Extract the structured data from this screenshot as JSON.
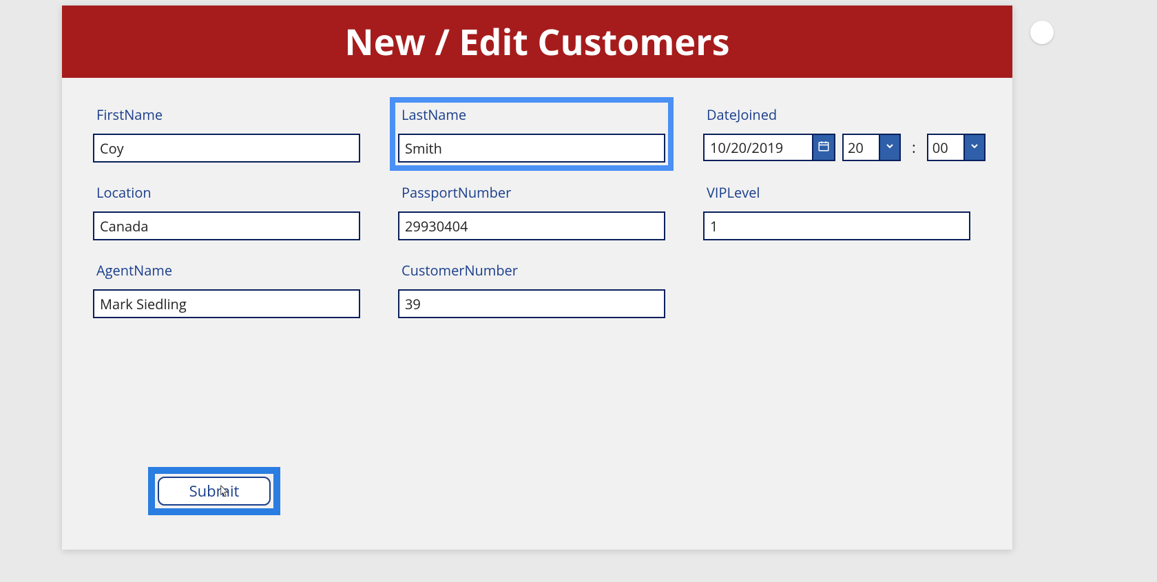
{
  "header": {
    "title": "New / Edit Customers"
  },
  "fields": {
    "firstName": {
      "label": "FirstName",
      "value": "Coy"
    },
    "lastName": {
      "label": "LastName",
      "value": "Smith"
    },
    "dateJoined": {
      "label": "DateJoined",
      "value": "10/20/2019",
      "hours": "20",
      "minutes": "00",
      "separator": ":"
    },
    "location": {
      "label": "Location",
      "value": "Canada"
    },
    "passportNumber": {
      "label": "PassportNumber",
      "value": "29930404"
    },
    "vipLevel": {
      "label": "VIPLevel",
      "value": "1"
    },
    "agentName": {
      "label": "AgentName",
      "value": "Mark Siedling"
    },
    "customerNumber": {
      "label": "CustomerNumber",
      "value": "39"
    }
  },
  "actions": {
    "submit": "Submit"
  }
}
